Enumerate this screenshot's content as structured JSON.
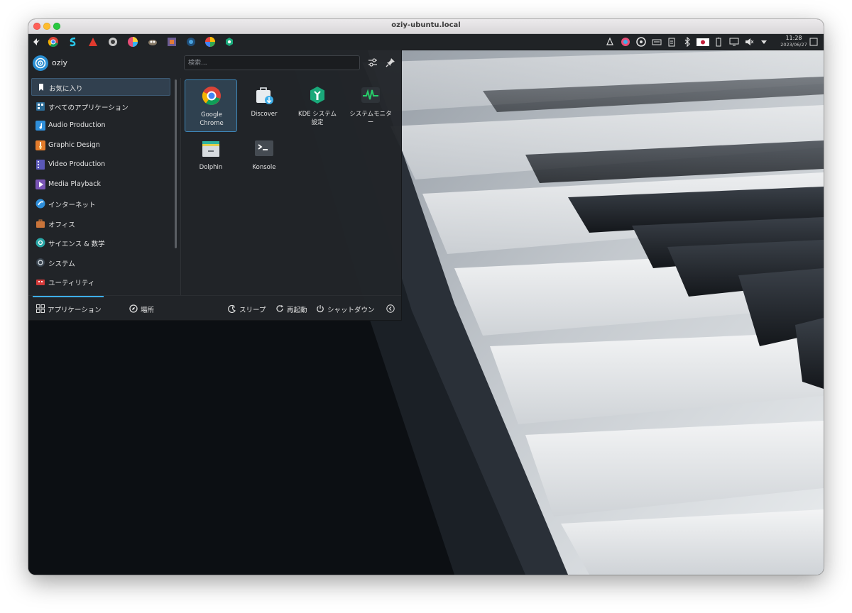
{
  "window": {
    "title": "oziy-ubuntu.local"
  },
  "panel": {
    "clock_time": "11:28",
    "clock_date": "2023/06/27",
    "task_icons": [
      "kde-icon",
      "chrome-icon",
      "s-app-icon",
      "red-triangle-icon",
      "gear-app-icon",
      "color-ball-icon",
      "gimp-icon",
      "box-app-icon",
      "blue-ring-icon",
      "color-wheel-icon",
      "green-app-icon"
    ],
    "tray_icons": [
      "alarm-icon",
      "color-picker-icon",
      "disk-icon",
      "keyboard-icon",
      "clipboard-icon",
      "bluetooth-icon",
      "japan-flag-icon",
      "battery-icon",
      "display-icon",
      "volume-icon",
      "expand-arrow-icon",
      "show-desktop-icon"
    ]
  },
  "launcher": {
    "username": "oziy",
    "search_placeholder": "検索...",
    "categories": [
      {
        "label": "お気に入り",
        "icon": "bookmark-icon",
        "active": true
      },
      {
        "label": "すべてのアプリケーション",
        "icon": "grid-apps-icon"
      },
      {
        "label": "Audio Production",
        "icon": "music-note-icon"
      },
      {
        "label": "Graphic Design",
        "icon": "brush-icon"
      },
      {
        "label": "Video Production",
        "icon": "film-icon"
      },
      {
        "label": "Media Playback",
        "icon": "play-icon"
      },
      {
        "label": "インターネット",
        "icon": "globe-icon"
      },
      {
        "label": "オフィス",
        "icon": "briefcase-icon"
      },
      {
        "label": "サイエンス & 数学",
        "icon": "atom-icon"
      },
      {
        "label": "システム",
        "icon": "system-gear-icon"
      },
      {
        "label": "ユーティリティ",
        "icon": "toolbox-icon"
      }
    ],
    "apps": [
      {
        "label": "Google Chrome",
        "icon": "chrome-icon",
        "active": true
      },
      {
        "label": "Discover",
        "icon": "discover-bag-icon"
      },
      {
        "label": "KDE システム設定",
        "icon": "system-settings-icon"
      },
      {
        "label": "システムモニター",
        "icon": "system-monitor-icon"
      },
      {
        "label": "Dolphin",
        "icon": "folder-icon"
      },
      {
        "label": "Konsole",
        "icon": "terminal-icon"
      }
    ],
    "footer": {
      "applications": "アプリケーション",
      "places": "場所",
      "sleep": "スリープ",
      "restart": "再起動",
      "shutdown": "シャットダウン"
    }
  }
}
